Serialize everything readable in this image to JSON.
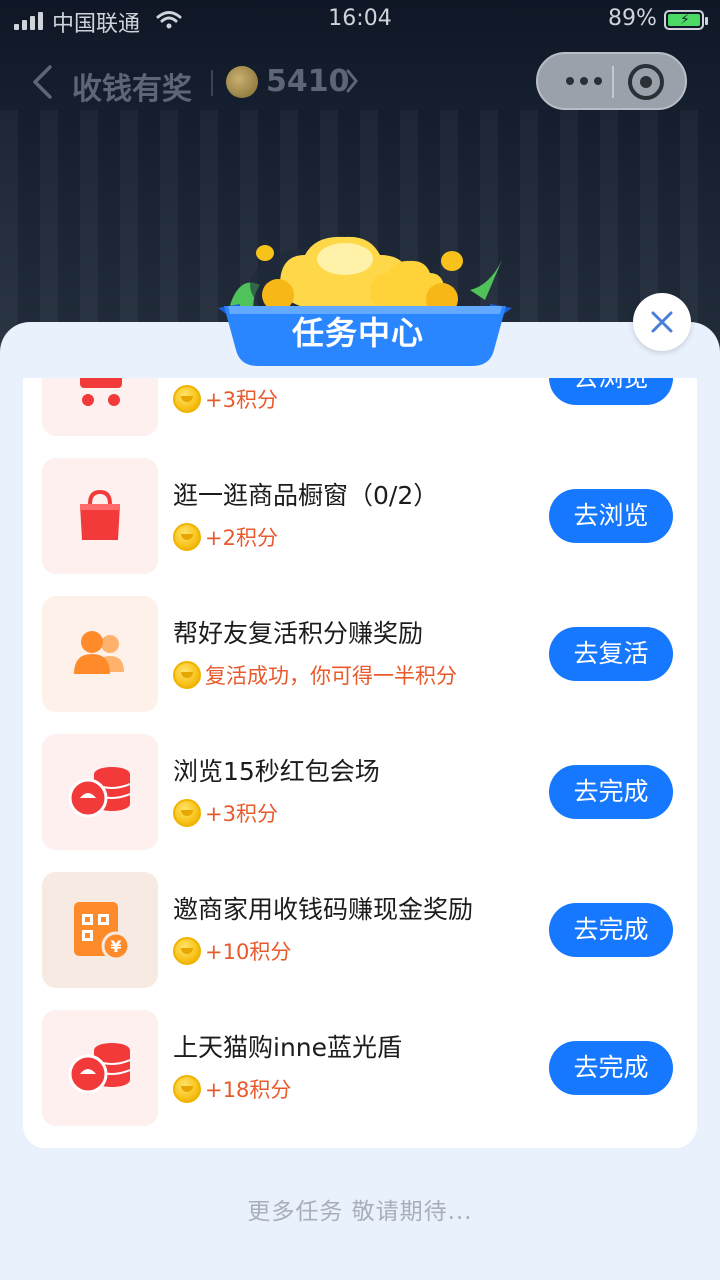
{
  "status_bar": {
    "carrier": "中国联通",
    "time": "16:04",
    "battery": "89%"
  },
  "nav": {
    "title": "收钱有奖",
    "points": "5410"
  },
  "sheet": {
    "title": "任务中心",
    "partial_task": {
      "reward": "+3积分",
      "button": "去浏览"
    },
    "tasks": [
      {
        "title": "逛一逛商品橱窗（0/2）",
        "reward": "+2积分",
        "button": "去浏览",
        "icon": "shopping-bag-icon"
      },
      {
        "title": "帮好友复活积分赚奖励",
        "reward": "复活成功，你可得一半积分",
        "button": "去复活",
        "icon": "friends-icon"
      },
      {
        "title": "浏览15秒红包会场",
        "reward": "+3积分",
        "button": "去完成",
        "icon": "coin-stack-icon"
      },
      {
        "title": "邀商家用收钱码赚现金奖励",
        "reward": "+10积分",
        "button": "去完成",
        "icon": "qr-code-yuan-icon"
      },
      {
        "title": "上天猫购inne蓝光盾",
        "reward": "+18积分",
        "button": "去完成",
        "icon": "coin-stack-icon"
      }
    ],
    "footer": "更多任务 敬请期待..."
  },
  "colors": {
    "primary_blue": "#1677ff",
    "reward_orange": "#e85a2c",
    "sheet_bg": "#e9f1fc"
  }
}
